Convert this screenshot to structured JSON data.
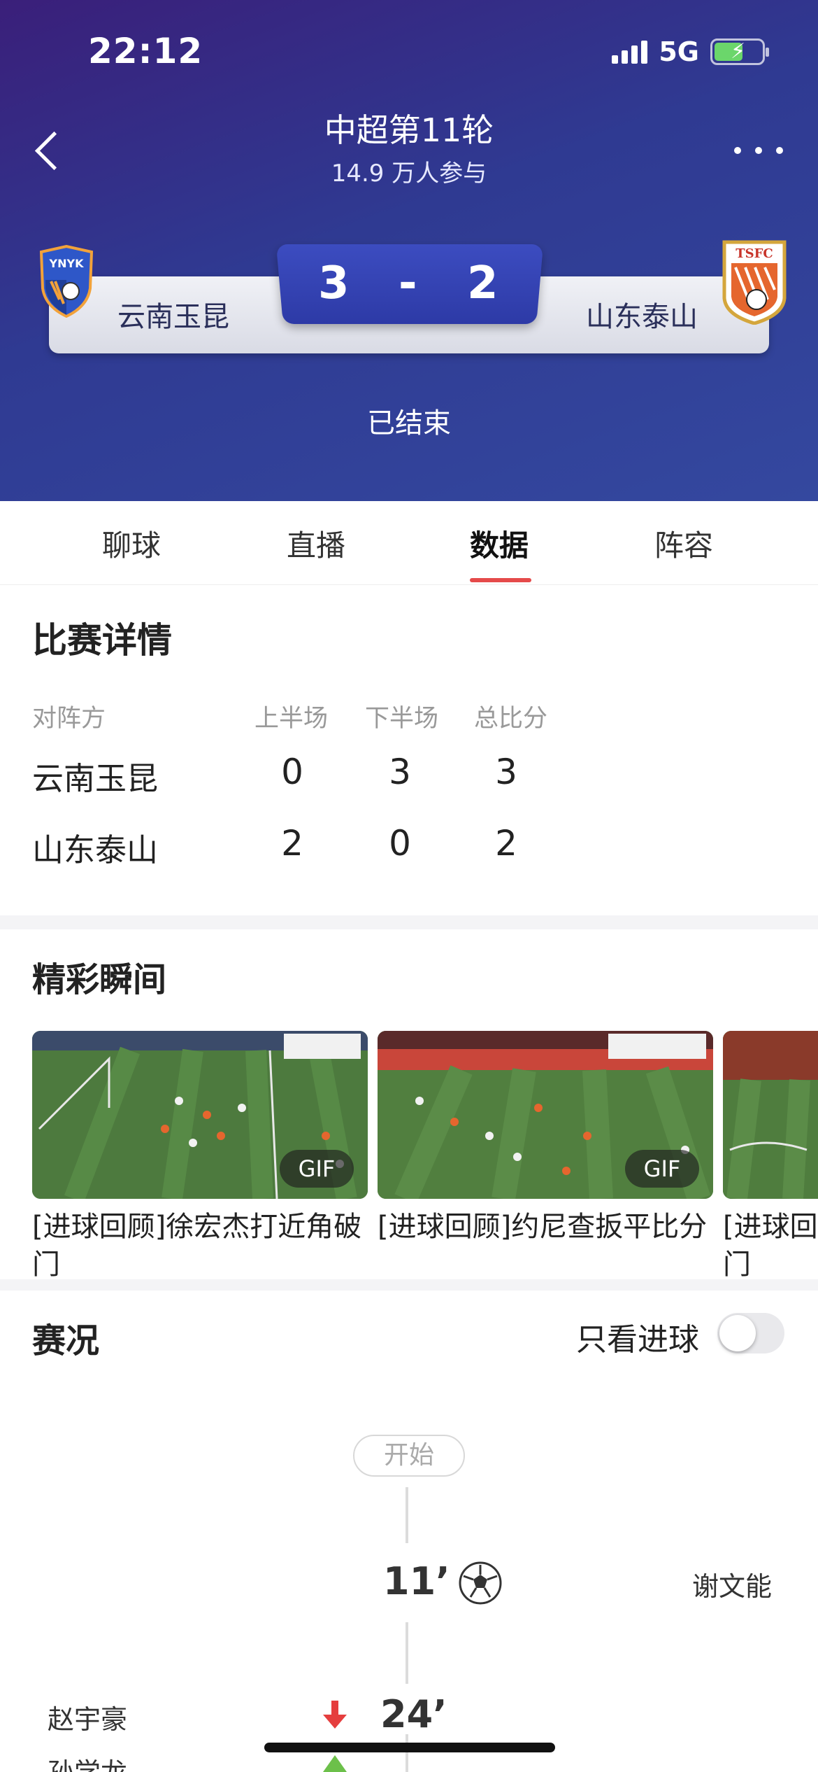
{
  "status_bar": {
    "time": "22:12",
    "network": "5G"
  },
  "header": {
    "title": "中超第11轮",
    "participants": "14.9 万人参与",
    "home_team": "云南玉昆",
    "away_team": "山东泰山",
    "home_score": "3",
    "separator": "-",
    "away_score": "2",
    "home_logo_text": "YNYK",
    "away_logo_text": "TSFC",
    "status": "已结束"
  },
  "tabs": [
    {
      "label": "聊球"
    },
    {
      "label": "直播"
    },
    {
      "label": "数据",
      "active": true
    },
    {
      "label": "阵容"
    }
  ],
  "match_detail": {
    "title": "比赛详情",
    "headers": [
      "对阵方",
      "上半场",
      "下半场",
      "总比分"
    ],
    "rows": [
      {
        "team": "云南玉昆",
        "first_half": "0",
        "second_half": "3",
        "total": "3"
      },
      {
        "team": "山东泰山",
        "first_half": "2",
        "second_half": "0",
        "total": "2"
      }
    ]
  },
  "highlights": {
    "title": "精彩瞬间",
    "items": [
      {
        "caption": "[进球回顾]徐宏杰打近角破门",
        "badge": "GIF"
      },
      {
        "caption": "[进球回顾]约尼查扳平比分",
        "badge": "GIF"
      },
      {
        "caption": "[进球回门"
      }
    ]
  },
  "live": {
    "title": "赛况",
    "filter_label": "只看进球",
    "filter_on": false,
    "start_label": "开始",
    "events": [
      {
        "minute": "11’",
        "type": "goal",
        "away_player": "谢文能"
      },
      {
        "minute": "24’",
        "type": "substitution",
        "home_player_out": "赵宇豪",
        "home_player_in": "孙学龙"
      }
    ]
  },
  "colors": {
    "header_bg": "#2f3a92",
    "score_box": "#3444b4",
    "tab_indicator": "#e54a4a",
    "sub_out": "#e53e3e",
    "sub_in": "#6cc04a"
  }
}
